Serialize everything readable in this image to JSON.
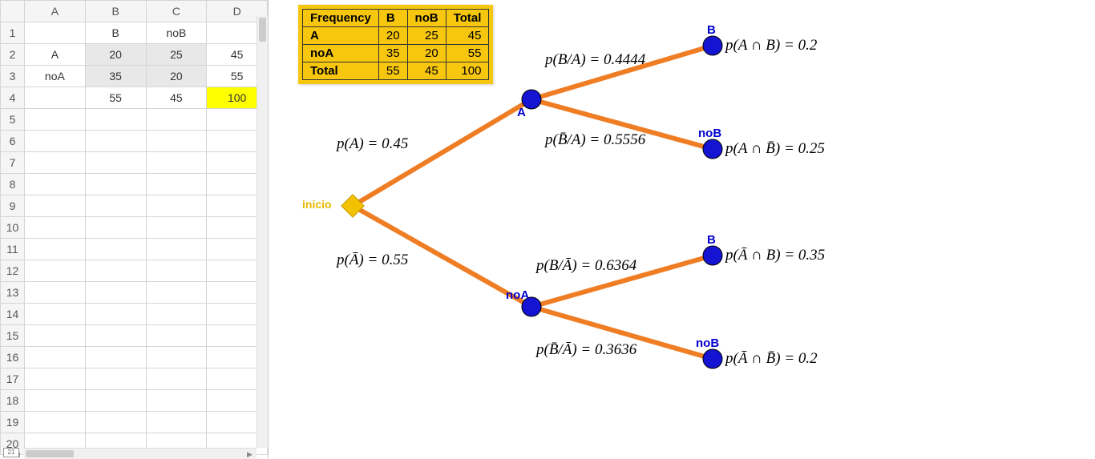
{
  "spreadsheet": {
    "columns": [
      "A",
      "B",
      "C",
      "D"
    ],
    "rows": [
      {
        "n": "1",
        "cells": [
          "",
          "B",
          "noB",
          ""
        ]
      },
      {
        "n": "2",
        "cells": [
          "A",
          "20",
          "25",
          "45"
        ]
      },
      {
        "n": "3",
        "cells": [
          "noA",
          "35",
          "20",
          "55"
        ]
      },
      {
        "n": "4",
        "cells": [
          "",
          "55",
          "45",
          "100"
        ]
      },
      {
        "n": "5",
        "cells": [
          "",
          "",
          "",
          ""
        ]
      },
      {
        "n": "6",
        "cells": [
          "",
          "",
          "",
          ""
        ]
      },
      {
        "n": "7",
        "cells": [
          "",
          "",
          "",
          ""
        ]
      },
      {
        "n": "8",
        "cells": [
          "",
          "",
          "",
          ""
        ]
      },
      {
        "n": "9",
        "cells": [
          "",
          "",
          "",
          ""
        ]
      },
      {
        "n": "10",
        "cells": [
          "",
          "",
          "",
          ""
        ]
      },
      {
        "n": "11",
        "cells": [
          "",
          "",
          "",
          ""
        ]
      },
      {
        "n": "12",
        "cells": [
          "",
          "",
          "",
          ""
        ]
      },
      {
        "n": "13",
        "cells": [
          "",
          "",
          "",
          ""
        ]
      },
      {
        "n": "14",
        "cells": [
          "",
          "",
          "",
          ""
        ]
      },
      {
        "n": "15",
        "cells": [
          "",
          "",
          "",
          ""
        ]
      },
      {
        "n": "16",
        "cells": [
          "",
          "",
          "",
          ""
        ]
      },
      {
        "n": "17",
        "cells": [
          "",
          "",
          "",
          ""
        ]
      },
      {
        "n": "18",
        "cells": [
          "",
          "",
          "",
          ""
        ]
      },
      {
        "n": "19",
        "cells": [
          "",
          "",
          "",
          ""
        ]
      },
      {
        "n": "20",
        "cells": [
          "",
          "",
          "",
          ""
        ]
      }
    ],
    "last_row_label": "21"
  },
  "freq_table": {
    "header": [
      "Frequency",
      "B",
      "noB",
      "Total"
    ],
    "rows": [
      [
        "A",
        "20",
        "25",
        "45"
      ],
      [
        "noA",
        "35",
        "20",
        "55"
      ],
      [
        "Total",
        "55",
        "45",
        "100"
      ]
    ]
  },
  "tree": {
    "start_label": "inicio",
    "nodes": {
      "A": "A",
      "noA": "noA",
      "B": "B",
      "noB": "noB"
    },
    "branch_probs": {
      "pA": "p(A) = 0.45",
      "pAbar": "p(Ā) = 0.55",
      "pB_A": "p(B/A) = 0.4444",
      "pBbar_A": "p(B̄/A) = 0.5556",
      "pB_Abar": "p(B/Ā) = 0.6364",
      "pBbar_Abar": "p(B̄/Ā) = 0.3636"
    },
    "leaf_probs": {
      "AiB": "p(A ∩ B) = 0.2",
      "AiBbar": "p(A ∩ B̄) = 0.25",
      "AbariB": "p(Ā ∩ B) = 0.35",
      "AbariBbar": "p(Ā ∩ B̄) = 0.2"
    }
  },
  "chart_data": {
    "type": "tree",
    "title": "Contingency table and probability tree",
    "contingency": {
      "row_labels": [
        "A",
        "noA"
      ],
      "col_labels": [
        "B",
        "noB"
      ],
      "counts": [
        [
          20,
          25
        ],
        [
          35,
          20
        ]
      ],
      "row_totals": [
        45,
        55
      ],
      "col_totals": [
        55,
        45
      ],
      "grand_total": 100
    },
    "marginal": {
      "p_A": 0.45,
      "p_notA": 0.55
    },
    "conditional": {
      "p_B_given_A": 0.4444,
      "p_notB_given_A": 0.5556,
      "p_B_given_notA": 0.6364,
      "p_notB_given_notA": 0.3636
    },
    "joint": {
      "p_A_and_B": 0.2,
      "p_A_and_notB": 0.25,
      "p_notA_and_B": 0.35,
      "p_notA_and_notB": 0.2
    }
  }
}
